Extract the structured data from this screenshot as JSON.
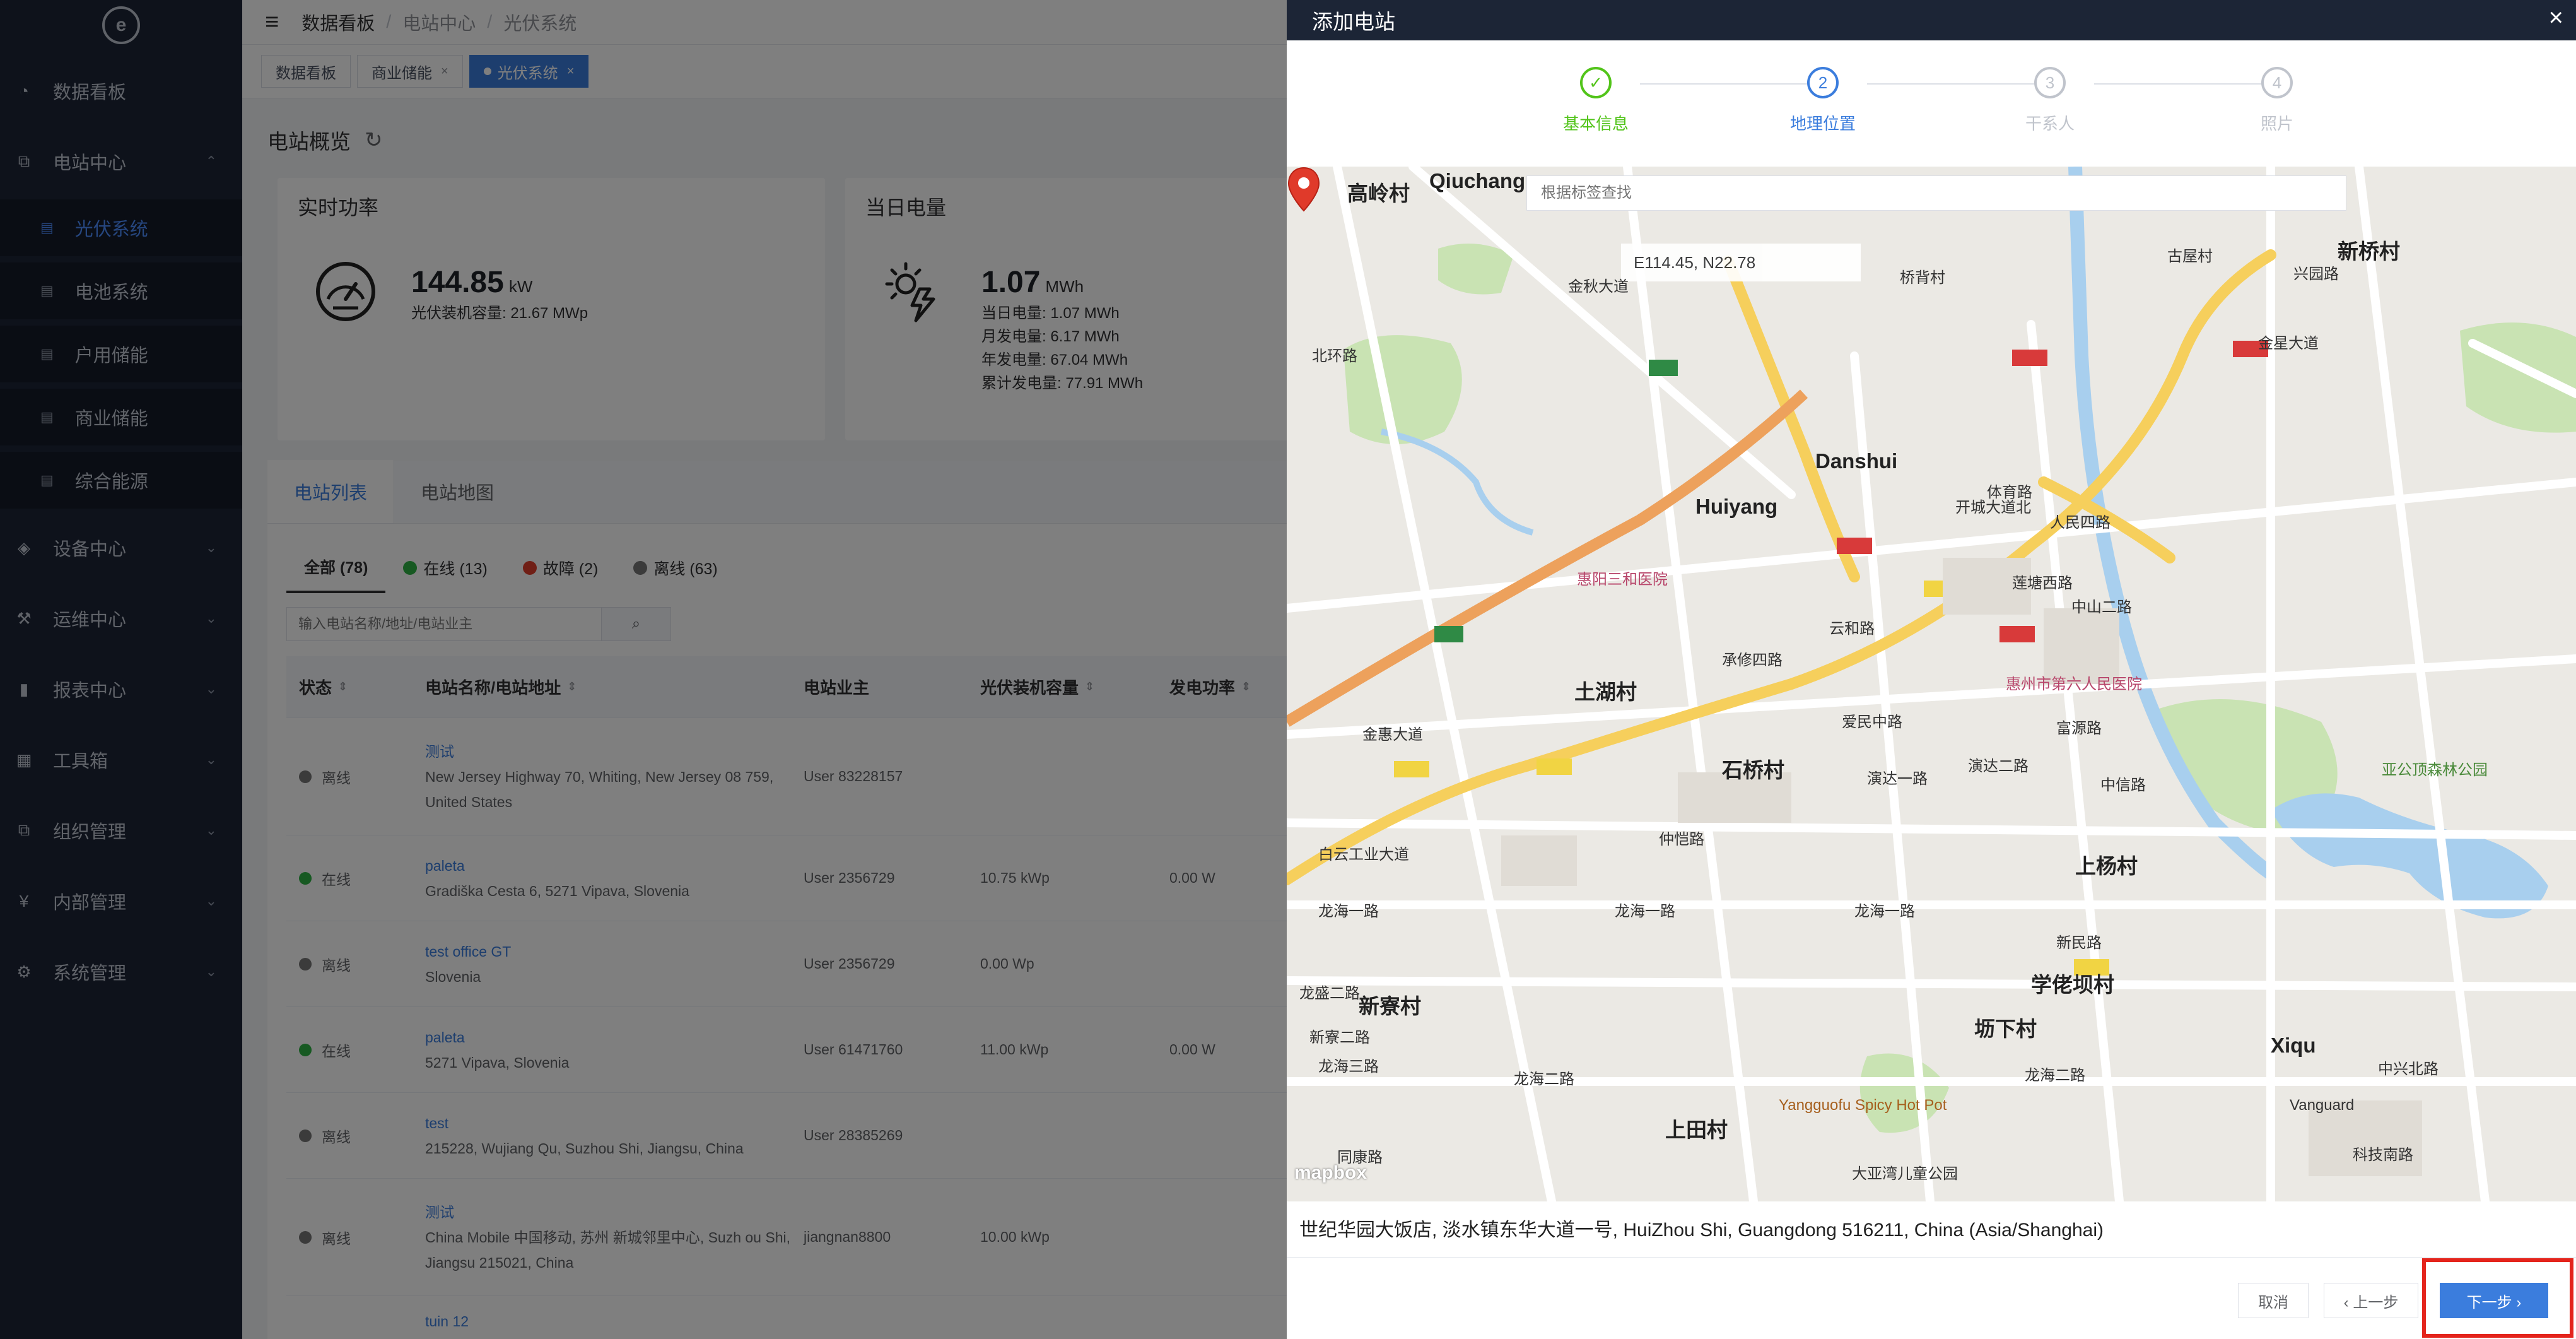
{
  "logo": {
    "glyph": "e"
  },
  "sidebar": {
    "items": [
      {
        "label": "数据看板",
        "icon": "dashboard-icon",
        "glyph": "◔"
      },
      {
        "label": "电站中心",
        "icon": "station-icon",
        "glyph": "⧉",
        "expanded": true
      },
      {
        "label": "设备中心",
        "icon": "device-icon",
        "glyph": "◈"
      },
      {
        "label": "运维中心",
        "icon": "maintenance-icon",
        "glyph": "⚒"
      },
      {
        "label": "报表中心",
        "icon": "report-icon",
        "glyph": "▮"
      },
      {
        "label": "工具箱",
        "icon": "toolbox-icon",
        "glyph": "▦"
      },
      {
        "label": "组织管理",
        "icon": "org-icon",
        "glyph": "⧉"
      },
      {
        "label": "内部管理",
        "icon": "yen-icon",
        "glyph": "¥"
      },
      {
        "label": "系统管理",
        "icon": "gear-icon",
        "glyph": "⚙"
      }
    ],
    "subitems": [
      "光伏系统",
      "电池系统",
      "户用储能",
      "商业储能",
      "综合能源"
    ],
    "chevron": "⌃",
    "chevron_down": "⌄",
    "sub_glyph": "▤"
  },
  "topbar": {
    "menu_glyph": "≡",
    "sep": "/",
    "breadcrumb": [
      "数据看板",
      "电站中心",
      "光伏系统"
    ]
  },
  "tags": [
    {
      "label": "数据看板"
    },
    {
      "label": "商业储能",
      "close": "×"
    },
    {
      "label": "光伏系统",
      "close": "×"
    }
  ],
  "overview": {
    "title": "电站概览",
    "refresh_glyph": "↻"
  },
  "power_card": {
    "title": "实时功率",
    "value": "144.85",
    "unit": "kW",
    "capacity": "光伏装机容量: 21.67 MWp"
  },
  "energy_card": {
    "title": "当日电量",
    "value": "1.07",
    "unit": "MWh",
    "lines": [
      "当日电量: 1.07 MWh",
      "月发电量: 6.17 MWh",
      "年发电量: 67.04 MWh",
      "累计发电量: 77.91 MWh"
    ]
  },
  "list_tabs": [
    "电站列表",
    "电站地图"
  ],
  "filters": [
    {
      "label": "全部 (78)",
      "color": ""
    },
    {
      "label": "在线 (13)",
      "color": "#2fb344"
    },
    {
      "label": "故障 (2)",
      "color": "#e03e2d"
    },
    {
      "label": "离线 (63)",
      "color": "#777777"
    }
  ],
  "search": {
    "placeholder": "输入电站名称/地址/电站业主",
    "icon": "⌕"
  },
  "table": {
    "sort_glyph": "⇕",
    "headers": [
      "状态",
      "电站名称/电站地址",
      "电站业主",
      "光伏装机容量",
      "发电功率"
    ],
    "rows": [
      {
        "status": "离线",
        "color": "#777777",
        "name": "测试",
        "addr": "New Jersey Highway 70, Whiting, New Jersey 08 759, United States",
        "owner": "User 83228157",
        "cap": "",
        "power": ""
      },
      {
        "status": "在线",
        "color": "#2fb344",
        "name": "paleta",
        "addr": "Gradiška Cesta 6, 5271 Vipava, Slovenia",
        "owner": "User 2356729",
        "cap": "10.75 kWp",
        "power": "0.00 W"
      },
      {
        "status": "离线",
        "color": "#777777",
        "name": "test office GT",
        "addr": "Slovenia",
        "owner": "User 2356729",
        "cap": "0.00 Wp",
        "power": ""
      },
      {
        "status": "在线",
        "color": "#2fb344",
        "name": "paleta",
        "addr": "5271 Vipava, Slovenia",
        "owner": "User 61471760",
        "cap": "11.00 kWp",
        "power": "0.00 W"
      },
      {
        "status": "离线",
        "color": "#777777",
        "name": "test",
        "addr": "215228, Wujiang Qu, Suzhou Shi, Jiangsu, China",
        "owner": "User 28385269",
        "cap": "",
        "power": ""
      },
      {
        "status": "离线",
        "color": "#777777",
        "name": "测试",
        "addr": "China Mobile 中国移动, 苏州 新城邻里中心, Suzh ou Shi, Jiangsu 215021, China",
        "owner": "jiangnan8800",
        "cap": "10.00 kWp",
        "power": ""
      },
      {
        "status": "",
        "color": "",
        "name": "tuin 12",
        "addr": "",
        "owner": "",
        "cap": "",
        "power": ""
      }
    ]
  },
  "drawer": {
    "title": "添加电站",
    "close_glyph": "×",
    "steps": [
      {
        "label": "基本信息",
        "glyph": "✓",
        "state": "done"
      },
      {
        "label": "地理位置",
        "glyph": "2",
        "state": "cur"
      },
      {
        "label": "干系人",
        "glyph": "3",
        "state": "todo"
      },
      {
        "label": "照片",
        "glyph": "4",
        "state": "todo"
      }
    ],
    "map_search_placeholder": "根据标签查找",
    "coords": "E114.45,  N22.78",
    "mapbox": "mapbox",
    "address": "世纪华园大饭店, 淡水镇东华大道一号, HuiZhou Shi, Guangdong 516211, China (Asia/Shanghai)",
    "buttons": {
      "cancel": "取消",
      "prev": "‹ 上一步",
      "next": "下一步 ›"
    }
  },
  "map_labels": [
    {
      "t": "高岭村",
      "c": "big"
    },
    {
      "t": "Qiuchang",
      "c": "big"
    },
    {
      "t": "桥背村",
      "c": ""
    },
    {
      "t": "古屋村",
      "c": ""
    },
    {
      "t": "新桥村",
      "c": "big"
    },
    {
      "t": "兴园路",
      "c": ""
    },
    {
      "t": "金星大道",
      "c": ""
    },
    {
      "t": "北环路",
      "c": ""
    },
    {
      "t": "金秋大道",
      "c": ""
    },
    {
      "t": "Danshui",
      "c": "big"
    },
    {
      "t": "Huiyang",
      "c": "big"
    },
    {
      "t": "惠阳三和医院",
      "c": "red"
    },
    {
      "t": "体育路",
      "c": ""
    },
    {
      "t": "开城大道北",
      "c": ""
    },
    {
      "t": "人民四路",
      "c": ""
    },
    {
      "t": "莲塘西路",
      "c": ""
    },
    {
      "t": "中山二路",
      "c": ""
    },
    {
      "t": "承修四路",
      "c": ""
    },
    {
      "t": "云和路",
      "c": ""
    },
    {
      "t": "土湖村",
      "c": "big"
    },
    {
      "t": "惠州市第六人民医院",
      "c": "red"
    },
    {
      "t": "金惠大道",
      "c": ""
    },
    {
      "t": "爱民中路",
      "c": ""
    },
    {
      "t": "石桥村",
      "c": "big"
    },
    {
      "t": "演达一路",
      "c": ""
    },
    {
      "t": "演达二路",
      "c": ""
    },
    {
      "t": "富源路",
      "c": ""
    },
    {
      "t": "中信路",
      "c": ""
    },
    {
      "t": "亚公顶森林公园",
      "c": "green"
    },
    {
      "t": "白云工业大道",
      "c": ""
    },
    {
      "t": "仲恺路",
      "c": ""
    },
    {
      "t": "上杨村",
      "c": "big"
    },
    {
      "t": "龙海一路",
      "c": ""
    },
    {
      "t": "龙海一路",
      "c": ""
    },
    {
      "t": "龙海一路",
      "c": ""
    },
    {
      "t": "新民路",
      "c": ""
    },
    {
      "t": "学佬坝村",
      "c": "big"
    },
    {
      "t": "新寮村",
      "c": "big"
    },
    {
      "t": "坜下村",
      "c": "big"
    },
    {
      "t": "龙海三路",
      "c": ""
    },
    {
      "t": "Xiqu",
      "c": "big"
    },
    {
      "t": "龙海二路",
      "c": ""
    },
    {
      "t": "龙海二路",
      "c": ""
    },
    {
      "t": "Yangguofu Spicy Hot Pot",
      "c": "brown"
    },
    {
      "t": "上田村",
      "c": "big"
    },
    {
      "t": "Vanguard",
      "c": ""
    },
    {
      "t": "大亚湾儿童公园",
      "c": ""
    },
    {
      "t": "科技南路",
      "c": ""
    },
    {
      "t": "中兴北路",
      "c": ""
    },
    {
      "t": "同康路",
      "c": ""
    },
    {
      "t": "新寮二路",
      "c": ""
    },
    {
      "t": "龙盛二路",
      "c": ""
    }
  ]
}
